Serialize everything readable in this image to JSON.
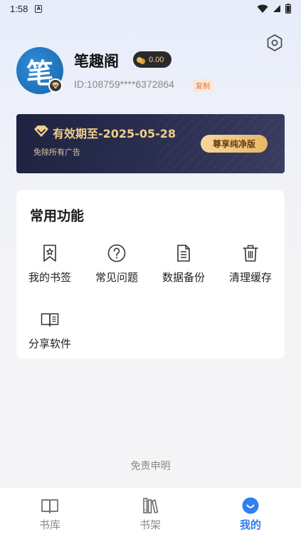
{
  "status_bar": {
    "time": "1:58"
  },
  "profile": {
    "avatar_char": "笔",
    "username": "笔趣阁",
    "coins": "0.00",
    "user_id": "ID:108759****6372864",
    "copy_label": "复制"
  },
  "vip": {
    "title": "有效期至-2025-05-28",
    "subtitle": "免除所有广告",
    "button_label": "尊享纯净版"
  },
  "functions": {
    "title": "常用功能",
    "items": [
      {
        "label": "我的书签",
        "icon": "bookmark-icon"
      },
      {
        "label": "常见问题",
        "icon": "question-icon"
      },
      {
        "label": "数据备份",
        "icon": "document-icon"
      },
      {
        "label": "清理缓存",
        "icon": "trash-icon"
      },
      {
        "label": "分享软件",
        "icon": "open-book-icon"
      }
    ]
  },
  "footer": {
    "disclaimer": "免责申明"
  },
  "tabs": [
    {
      "label": "书库",
      "icon": "book-icon",
      "active": false
    },
    {
      "label": "书架",
      "icon": "bookshelf-icon",
      "active": false
    },
    {
      "label": "我的",
      "icon": "profile-icon",
      "active": true
    }
  ],
  "colors": {
    "accent": "#2f7ff0",
    "vip_gold": "#f0cf8a",
    "vip_bg": "#23274a"
  }
}
